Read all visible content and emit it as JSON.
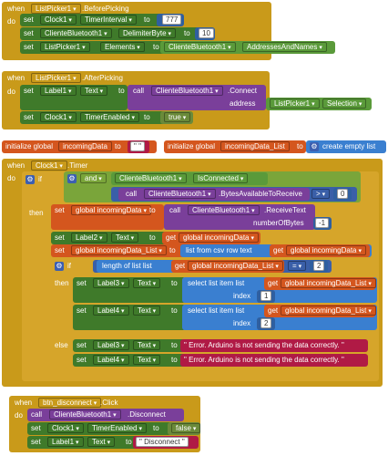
{
  "blocks": {
    "b1": {
      "when": "when",
      "component": "ListPicker1",
      "event": ".BeforePicking",
      "do": "do",
      "set": "set",
      "to": "to",
      "s1_comp": "Clock1",
      "s1_prop": "TimerInterval",
      "s1_val": "777",
      "s2_comp": "ClienteBluetooth1",
      "s2_prop": "DelimiterByte",
      "s2_val": "10",
      "s3_comp": "ListPicker1",
      "s3_prop": "Elements",
      "s3_src": "ClienteBluetooth1",
      "s3_srcprop": "AddressesAndNames"
    },
    "b2": {
      "when": "when",
      "component": "ListPicker1",
      "event": ".AfterPicking",
      "do": "do",
      "set": "set",
      "to": "to",
      "call": "call",
      "s1_comp": "Label1",
      "s1_prop": "Text",
      "c_comp": "ClienteBluetooth1",
      "c_method": ".Connect",
      "address": "address",
      "addr_comp": "ListPicker1",
      "addr_prop": "Selection",
      "s2_comp": "Clock1",
      "s2_prop": "TimerEnabled",
      "s2_val": "true"
    },
    "g1": {
      "init": "initialize global",
      "name": "incomingData",
      "to": "to",
      "val": "\" \""
    },
    "g2": {
      "init": "initialize global",
      "name": "incomingData_List",
      "to": "to",
      "val": "create empty list"
    },
    "b3": {
      "when": "when",
      "component": "Clock1",
      "event": ".Timer",
      "do": "do",
      "if": "if",
      "and": "and",
      "isconn_comp": "ClienteBluetooth1",
      "isconn_prop": "IsConnected",
      "call": "call",
      "bytes_comp": "ClienteBluetooth1",
      "bytes_method": ".BytesAvailableToReceive",
      "gt": ">",
      "zero": "0",
      "then": "then",
      "set": "set",
      "to": "to",
      "get": "get",
      "s1_var": "global incomingData",
      "recv_comp": "ClienteBluetooth1",
      "recv_method": ".ReceiveText",
      "numbytes": "numberOfBytes",
      "neg1": "-1",
      "s2_comp": "Label2",
      "s2_prop": "Text",
      "s2_get": "global incomingData",
      "s3_var": "global incomingData_List",
      "csv": "list from csv row  text",
      "s3_get": "global incomingData",
      "inner_if": "if",
      "len": "length of list  list",
      "len_get": "global incomingData_List",
      "eq": "=",
      "two": "2",
      "inner_then": "then",
      "t1_comp": "Label3",
      "t1_prop": "Text",
      "select": "select list item  list",
      "t1_get": "global incomingData_List",
      "index": "index",
      "one": "1",
      "t2_comp": "Label4",
      "t2_prop": "Text",
      "t2_get": "global incomingData_List",
      "two_b": "2",
      "else": "else",
      "e1_comp": "Label3",
      "e1_prop": "Text",
      "e1_txt": "\" Error. Arduino is not sending the data correctly. \"",
      "e2_comp": "Label4",
      "e2_prop": "Text",
      "e2_txt": "\" Error. Arduino is not sending the data correctly. \""
    },
    "b4": {
      "when": "when",
      "component": "btn_disconnect",
      "event": ".Click",
      "do": "do",
      "call": "call",
      "c_comp": "ClienteBluetooth1",
      "c_method": ".Disconnect",
      "set": "set",
      "to": "to",
      "s1_comp": "Clock1",
      "s1_prop": "TimerEnabled",
      "s1_val": "false",
      "s2_comp": "Label1",
      "s2_prop": "Text",
      "s2_val": "\" Disconnect \""
    }
  },
  "colors": {
    "event": "#c99a1a",
    "setter": "#3f7a2a",
    "call": "#7a3f9a",
    "variable": "#d4561e",
    "list": "#3a7fd0",
    "text": "#b01a45",
    "logic": "#3f6da8"
  }
}
